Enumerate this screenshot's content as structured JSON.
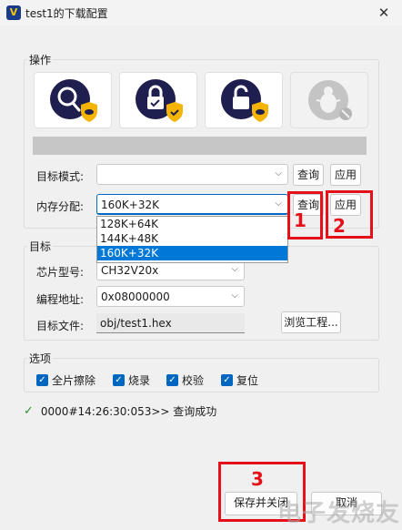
{
  "window": {
    "title": "test1的下载配置",
    "close_glyph": "✕"
  },
  "operations": {
    "label": "操作",
    "buttons": [
      {
        "name": "query-chip-button",
        "icon": "magnifier-shield-icon"
      },
      {
        "name": "protect-chip-button",
        "icon": "lock-check-shield-icon"
      },
      {
        "name": "unprotect-chip-button",
        "icon": "unlock-shield-icon"
      },
      {
        "name": "debug-button",
        "icon": "bug-disabled-icon"
      }
    ],
    "progress": 0
  },
  "target_mode": {
    "label": "目标模式:",
    "value": "",
    "query": "查询",
    "apply": "应用"
  },
  "memory": {
    "label": "内存分配:",
    "value": "160K+32K",
    "query": "查询",
    "apply": "应用",
    "options": [
      "128K+64K",
      "144K+48K",
      "160K+32K"
    ],
    "selected_index": 2
  },
  "target": {
    "label": "目标",
    "chip_label": "芯片型号:",
    "chip_value": "CH32V20x",
    "address_label": "编程地址:",
    "address_value": "0x08000000",
    "file_label": "目标文件:",
    "file_value": "obj/test1.hex",
    "browse": "浏览工程..."
  },
  "options": {
    "label": "选项",
    "items": [
      {
        "label": "全片擦除",
        "checked": true
      },
      {
        "label": "烧录",
        "checked": true
      },
      {
        "label": "校验",
        "checked": true
      },
      {
        "label": "复位",
        "checked": true
      }
    ]
  },
  "status": {
    "icon": "checkmark",
    "text": "0000#14:26:30:053>> 查询成功"
  },
  "footer": {
    "save": "保存并关闭",
    "cancel": "取消"
  },
  "annotations": {
    "n1": "1",
    "n2": "2",
    "n3": "3",
    "color": "#e4101a"
  },
  "watermark": "电子发烧友",
  "chevron": "⌵",
  "check_glyph": "✓"
}
